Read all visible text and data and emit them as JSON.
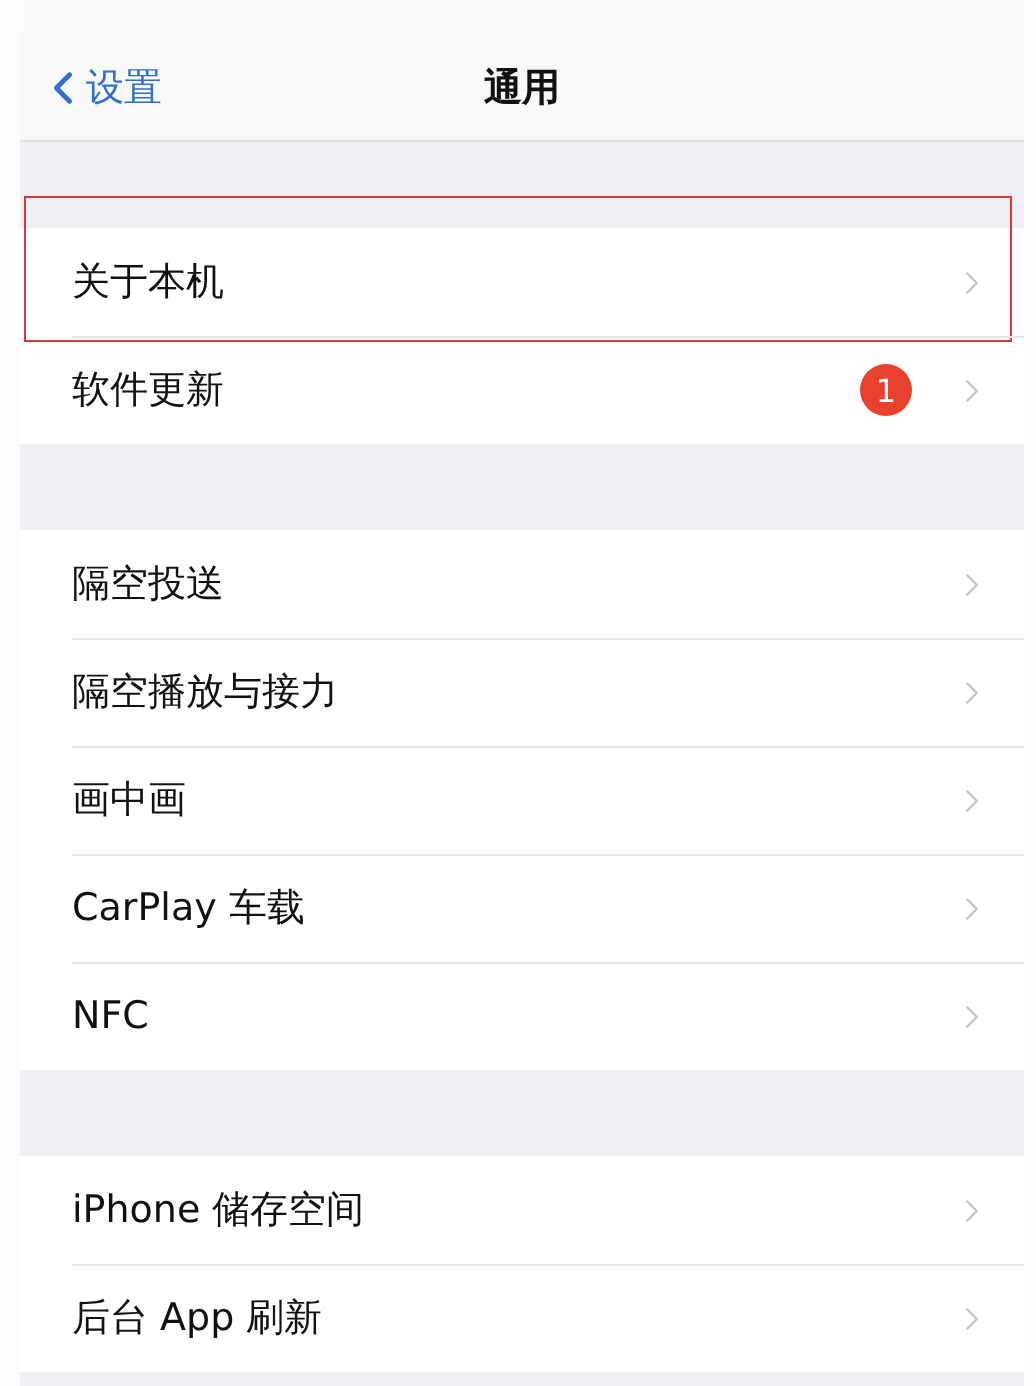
{
  "nav": {
    "back_label": "设置",
    "title": "通用"
  },
  "sections": [
    {
      "items": [
        {
          "label": "关于本机",
          "highlighted": true
        },
        {
          "label": "软件更新",
          "badge": "1",
          "highlighted": false
        }
      ]
    },
    {
      "items": [
        {
          "label": "隔空投送",
          "highlighted": false
        },
        {
          "label": "隔空播放与接力",
          "highlighted": false
        },
        {
          "label": "画中画",
          "highlighted": false
        },
        {
          "label": "CarPlay 车载",
          "highlighted": false
        },
        {
          "label": "NFC",
          "highlighted": false
        }
      ]
    },
    {
      "items": [
        {
          "label": "iPhone 储存空间",
          "highlighted": false
        },
        {
          "label": "后台 App 刷新",
          "highlighted": false
        }
      ]
    }
  ]
}
